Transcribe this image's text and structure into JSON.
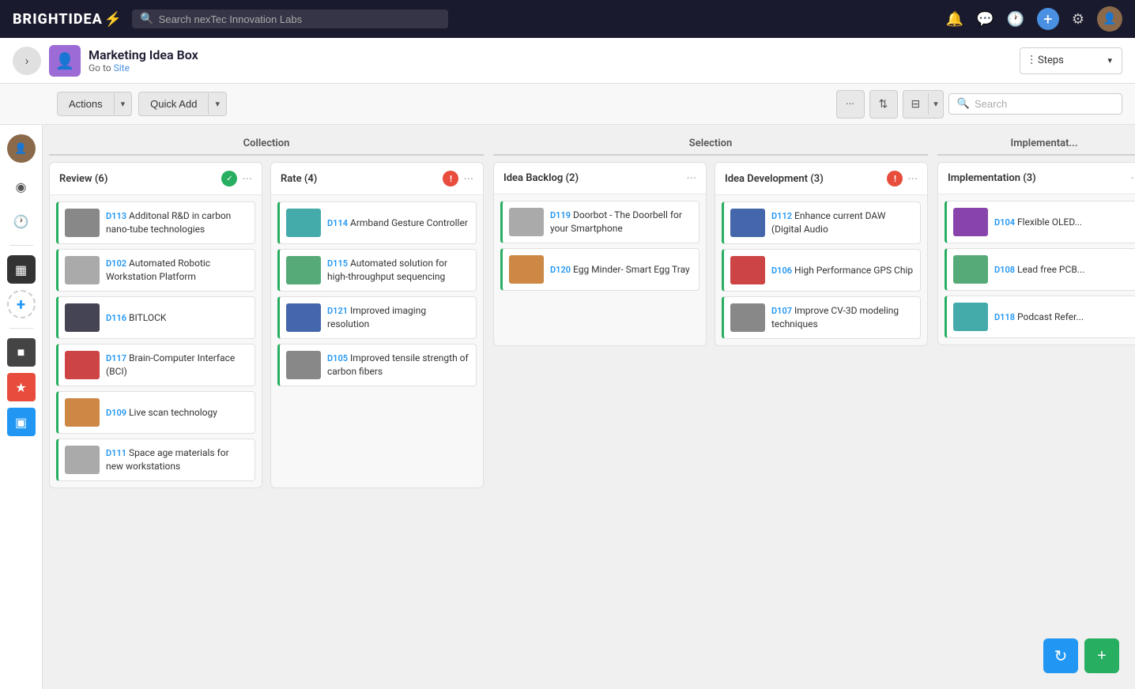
{
  "app": {
    "logo": "BRIGHTIDEA",
    "logo_lightning": "⚡"
  },
  "topnav": {
    "search_placeholder": "Search nexTec Innovation Labs",
    "icons": [
      "🔔",
      "💬",
      "🕐",
      "⊕",
      "⚙"
    ],
    "avatar_text": "👤"
  },
  "subheader": {
    "page_icon": "👤",
    "title": "Marketing Idea Box",
    "subtitle_prefix": "Go to",
    "subtitle_link": "Site",
    "steps_label": "Steps",
    "steps_icon": "|||"
  },
  "toolbar": {
    "actions_label": "Actions",
    "quick_add_label": "Quick Add",
    "search_placeholder": "Search",
    "filter_label": "⊟"
  },
  "sidebar": {
    "items": [
      {
        "id": "dashboard",
        "icon": "◉",
        "active": false
      },
      {
        "id": "clock",
        "icon": "🕐",
        "active": false
      },
      {
        "id": "divider"
      },
      {
        "id": "active-dark",
        "icon": "▪",
        "active_dark": true
      },
      {
        "id": "add",
        "icon": "+",
        "add": true
      },
      {
        "id": "divider2"
      },
      {
        "id": "square-dark",
        "icon": "■",
        "dark": true
      },
      {
        "id": "star",
        "icon": "★",
        "orange": true
      },
      {
        "id": "blue2",
        "icon": "▣",
        "blue2": true
      }
    ]
  },
  "board": {
    "sections": [
      {
        "id": "collection",
        "title": "Collection",
        "columns": [
          {
            "id": "review",
            "title": "Review (6)",
            "status": "green",
            "status_icon": "✓",
            "ideas": [
              {
                "id": "D113",
                "title": "Additonal R&D in carbon nano-tube technologies",
                "thumb_color": "gray1"
              },
              {
                "id": "D102",
                "title": "Automated Robotic Workstation Platform",
                "thumb_color": "gray2"
              },
              {
                "id": "D116",
                "title": "BITLOCK",
                "thumb_color": "dark1"
              },
              {
                "id": "D117",
                "title": "Brain-Computer Interface (BCI)",
                "thumb_color": "red1"
              },
              {
                "id": "D109",
                "title": "Live scan technology",
                "thumb_color": "orange1"
              },
              {
                "id": "D111",
                "title": "Space age materials for new workstations",
                "thumb_color": "gray2"
              }
            ]
          },
          {
            "id": "rate",
            "title": "Rate (4)",
            "status": "red",
            "status_icon": "!",
            "ideas": [
              {
                "id": "D114",
                "title": "Armband Gesture Controller",
                "thumb_color": "teal1"
              },
              {
                "id": "D115",
                "title": "Automated solution for high-throughput sequencing",
                "thumb_color": "green1"
              },
              {
                "id": "D121",
                "title": "Improved imaging resolution",
                "thumb_color": "blue1"
              },
              {
                "id": "D105",
                "title": "Improved tensile strength of carbon fibers",
                "thumb_color": "gray1"
              }
            ]
          }
        ]
      },
      {
        "id": "selection",
        "title": "Selection",
        "columns": [
          {
            "id": "idea-backlog",
            "title": "Idea Backlog (2)",
            "status": "none",
            "ideas": [
              {
                "id": "D119",
                "title": "Doorbot - The Doorbell for your Smartphone",
                "thumb_color": "gray2"
              },
              {
                "id": "D120",
                "title": "Egg Minder- Smart Egg Tray",
                "thumb_color": "orange1"
              }
            ]
          },
          {
            "id": "idea-development",
            "title": "Idea Development (3)",
            "status": "red",
            "status_icon": "!",
            "ideas": [
              {
                "id": "D112",
                "title": "Enhance current DAW (Digital Audio",
                "thumb_color": "blue1"
              },
              {
                "id": "D106",
                "title": "High Performance GPS Chip",
                "thumb_color": "red1"
              },
              {
                "id": "D107",
                "title": "Improve CV-3D modeling techniques",
                "thumb_color": "gray1"
              }
            ]
          }
        ]
      },
      {
        "id": "implementation",
        "title": "Implementat...",
        "columns": [
          {
            "id": "implementation-col",
            "title": "Implementation (3)",
            "status": "none",
            "ideas": [
              {
                "id": "D104",
                "title": "Flexible OLED...",
                "thumb_color": "purple1"
              },
              {
                "id": "D108",
                "title": "Lead free PCB...",
                "thumb_color": "green1"
              },
              {
                "id": "D118",
                "title": "Podcast Refer...",
                "thumb_color": "teal1"
              }
            ]
          }
        ]
      }
    ]
  },
  "bottom_actions": {
    "refresh_icon": "↻",
    "add_icon": "+"
  }
}
